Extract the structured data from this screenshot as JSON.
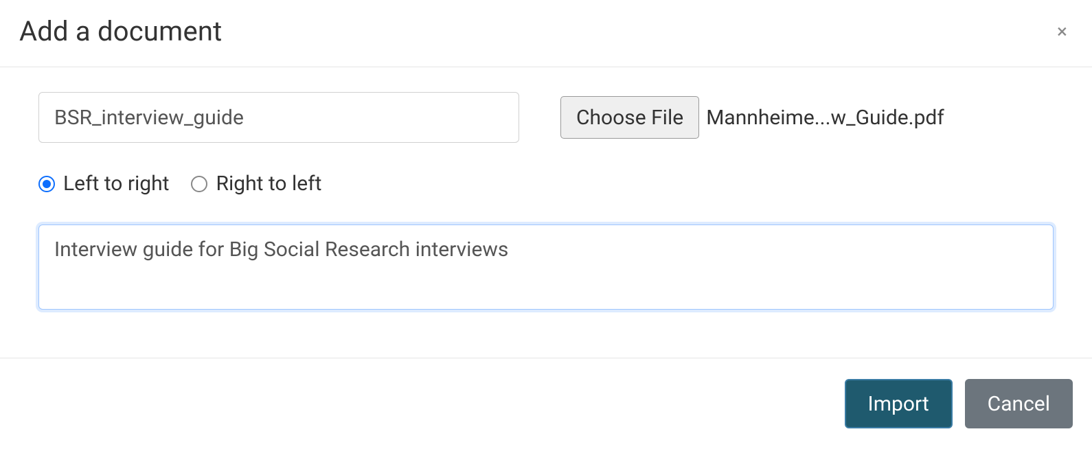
{
  "modal": {
    "title": "Add a document",
    "name_value": "BSR_interview_guide",
    "choose_file_label": "Choose File",
    "file_name": "Mannheime...w_Guide.pdf",
    "direction": {
      "ltr_label": "Left to right",
      "rtl_label": "Right to left",
      "selected": "ltr"
    },
    "description_value": "Interview guide for Big Social Research interviews",
    "import_label": "Import",
    "cancel_label": "Cancel"
  }
}
